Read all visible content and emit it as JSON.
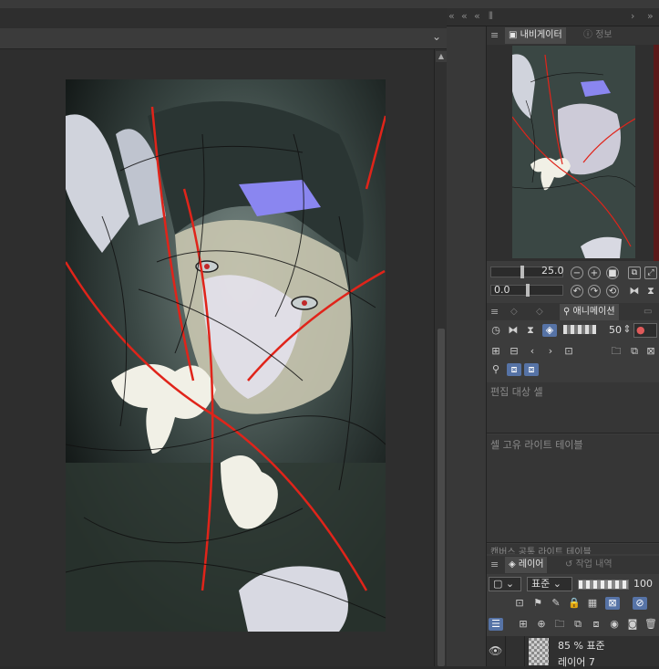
{
  "navigator": {
    "tab_navigator": "내비게이터",
    "tab_info": "정보",
    "zoom_value": "25.0",
    "rotation_value": "0.0"
  },
  "animation": {
    "tab_label": "애니메이션",
    "opacity_value": "50",
    "edit_target_label": "편집 대상 셀",
    "light_table_label": "셀 고유 라이트 테이블",
    "common_light_table_label": "캔버스 공통 라이트 테이블"
  },
  "layers": {
    "tab_layer": "레이어",
    "tab_history": "작업 내역",
    "blend_mode": "표준",
    "opacity": "100",
    "items": [
      {
        "info": "85 % 표준",
        "name": "레이어 7"
      }
    ]
  },
  "colors": {
    "background": "#2b2b2b",
    "panel": "#3c3c3c",
    "active_tab": "#4a4a4a",
    "accent_blue": "#5673a6"
  },
  "icons": {
    "panel_menu": "hamburger-icon",
    "collapse": "double-chevron-left-icon",
    "eye": "eye-icon"
  }
}
